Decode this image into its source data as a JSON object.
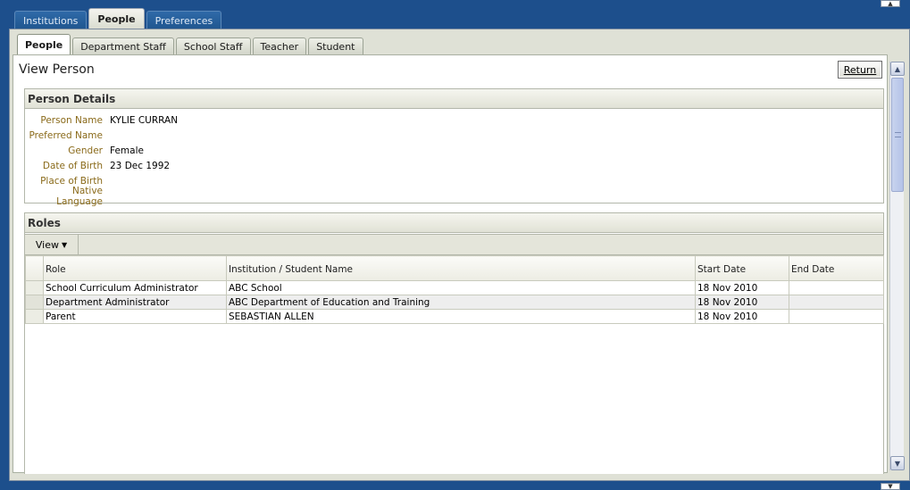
{
  "top_tabs": [
    "Institutions",
    "People",
    "Preferences"
  ],
  "sub_tabs": [
    "People",
    "Department Staff",
    "School Staff",
    "Teacher",
    "Student"
  ],
  "page_title": "View Person",
  "return_label": "Return",
  "person_details": {
    "heading": "Person Details",
    "fields": [
      {
        "label": "Person Name",
        "value": "KYLIE CURRAN"
      },
      {
        "label": "Preferred Name",
        "value": ""
      },
      {
        "label": "Gender",
        "value": "Female"
      },
      {
        "label": "Date of Birth",
        "value": "23 Dec 1992"
      },
      {
        "label": "Place of Birth",
        "value": ""
      },
      {
        "label": "Native Language",
        "value": ""
      }
    ]
  },
  "roles": {
    "heading": "Roles",
    "view_menu": "View",
    "columns": [
      "Role",
      "Institution / Student Name",
      "Start Date",
      "End Date"
    ],
    "rows": [
      {
        "role": "School Curriculum Administrator",
        "institution": "ABC School",
        "start": "18 Nov 2010",
        "end": ""
      },
      {
        "role": "Department Administrator",
        "institution": "ABC Department of Education and Training",
        "start": "18 Nov 2010",
        "end": ""
      },
      {
        "role": "Parent",
        "institution": "SEBASTIAN ALLEN",
        "start": "18 Nov 2010",
        "end": ""
      }
    ]
  },
  "icons": {
    "scroll_up": "triangle-up-icon",
    "scroll_down": "triangle-down-icon",
    "view_caret": "caret-down-icon"
  }
}
